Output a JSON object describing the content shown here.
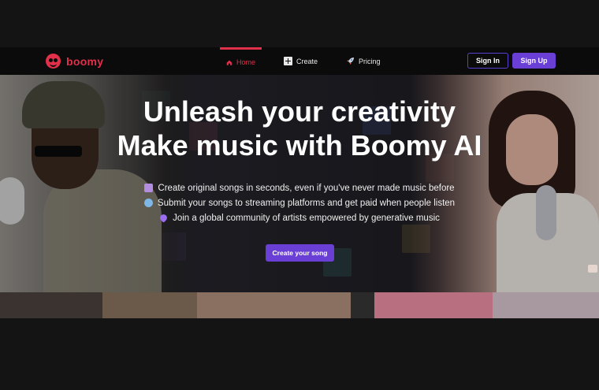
{
  "brand": {
    "name": "boomy",
    "accent": "#e0304a",
    "purple": "#6a3fd6"
  },
  "nav": {
    "items": [
      {
        "label": "Home",
        "icon": "home-icon",
        "active": true
      },
      {
        "label": "Create",
        "icon": "plus-square-icon",
        "active": false
      },
      {
        "label": "Pricing",
        "icon": "rocket-icon",
        "active": false
      }
    ]
  },
  "auth": {
    "signin_label": "Sign In",
    "signup_label": "Sign Up"
  },
  "hero": {
    "title_line1": "Unleash your creativity",
    "title_line2": "Make music with Boomy AI",
    "features": [
      {
        "icon": "music-notes-icon",
        "text": "Create original songs in seconds, even if you've never made music before"
      },
      {
        "icon": "globe-icon",
        "text": "Submit your songs to streaming platforms and get paid when people listen"
      },
      {
        "icon": "purple-heart-icon",
        "text": "Join a global community of artists empowered by generative music"
      }
    ],
    "cta_label": "Create your song"
  }
}
